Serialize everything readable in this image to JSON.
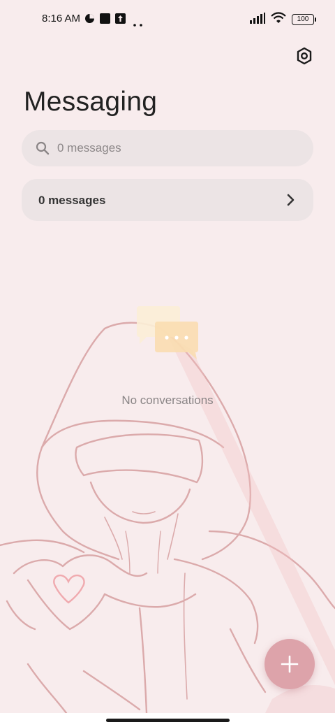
{
  "status_bar": {
    "time": "8:16 AM",
    "battery": "100",
    "icons": [
      "data-saver-icon",
      "square-notification-icon",
      "upload-icon",
      "more-dots-icon",
      "signal-icon",
      "wifi-icon",
      "battery-icon"
    ]
  },
  "header": {
    "title": "Messaging",
    "settings_icon": "settings-hex-icon"
  },
  "search": {
    "placeholder": "0 messages"
  },
  "messages_card": {
    "label": "0 messages"
  },
  "empty_state": {
    "text": "No conversations"
  },
  "fab": {
    "icon": "plus-icon"
  },
  "colors": {
    "background": "#f8eced",
    "card": "#ece4e5",
    "fab": "#dda3aa",
    "line_art": "#d9a6a6"
  }
}
